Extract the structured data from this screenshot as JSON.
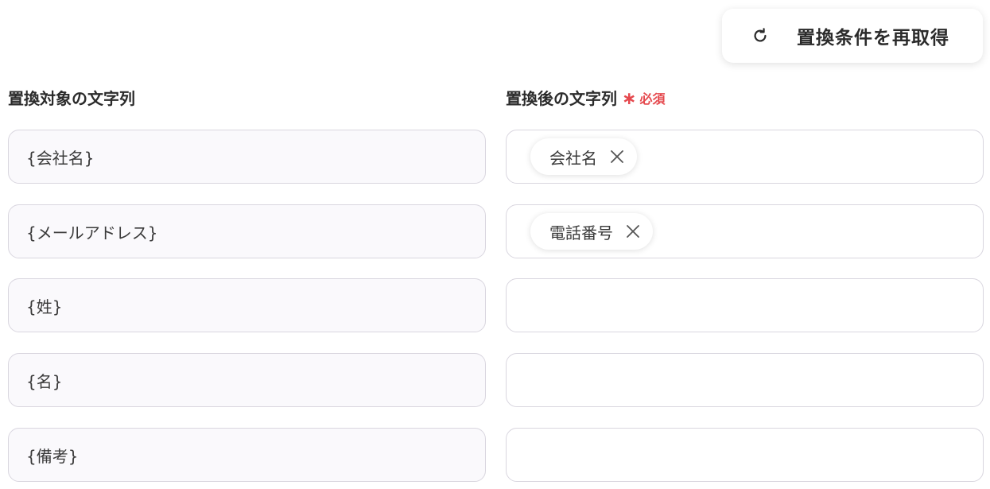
{
  "toolbar": {
    "refresh_label": "置換条件を再取得",
    "refresh_icon": "refresh-icon"
  },
  "columns": {
    "source_label": "置換対象の文字列",
    "target_label": "置換後の文字列",
    "required_mark": "∗",
    "required_text": "必須"
  },
  "colors": {
    "required": "#e5484d",
    "field_border": "#d9d6df",
    "source_bg": "#faf9fc"
  },
  "rows": [
    {
      "source": "{会社名}",
      "target_chip": "会社名"
    },
    {
      "source": "{メールアドレス}",
      "target_chip": "電話番号"
    },
    {
      "source": "{姓}",
      "target_chip": ""
    },
    {
      "source": "{名}",
      "target_chip": ""
    },
    {
      "source": "{備考}",
      "target_chip": ""
    }
  ]
}
